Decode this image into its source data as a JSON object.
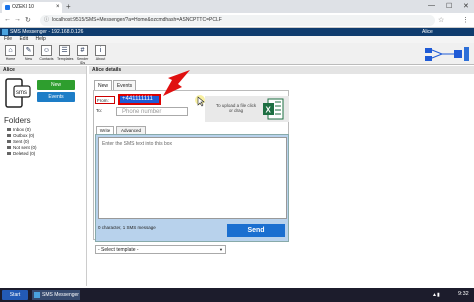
{
  "browser": {
    "tab_title": "OZEKI 10 (192.168.0.126)",
    "tab_close": "×",
    "new_tab": "+",
    "url": "localhost:9515/SMS+Messenger/?a=Home&ozcmdhash=ASNCPTTC=PCLF",
    "controls": [
      "—",
      "☐",
      "✕"
    ]
  },
  "app": {
    "title": "SMS Messenger - 192.168.0.126",
    "user": "Alice",
    "menu": [
      "File",
      "Edit",
      "Help"
    ],
    "toolbar": [
      "Home",
      "New",
      "Contacts",
      "Templates",
      "Sender IDs",
      "About"
    ]
  },
  "left": {
    "header": "Alice",
    "new_button": "New",
    "events_button": "Events",
    "folders_title": "Folders",
    "folders": [
      "Inbox (0)",
      "Outbox (0)",
      "Sent (0)",
      "Not sent (0)",
      "Deleted (0)"
    ]
  },
  "main": {
    "header": "Alice details",
    "tabs": [
      "New",
      "Events"
    ],
    "from_label": "From:",
    "from_value": "+441111111",
    "to_label": "To:",
    "phone_placeholder": "Phone number",
    "upload_text": "To upload a file click or drag",
    "subtabs": [
      "Write",
      "Advanced"
    ],
    "sms_placeholder": "Enter the SMS text into this box",
    "char_count": "0 character, 1 SMS message",
    "send_label": "Send",
    "template_label": "- Select template -"
  },
  "taskbar": {
    "start": "Start",
    "item": "SMS Messenger",
    "time": "9:32"
  },
  "colors": {
    "app_header": "#0f3c6e",
    "new_button": "#2e9e2e",
    "events_button": "#1d7dc7",
    "send_button": "#1a6fd0",
    "highlight": "#dd0000"
  }
}
